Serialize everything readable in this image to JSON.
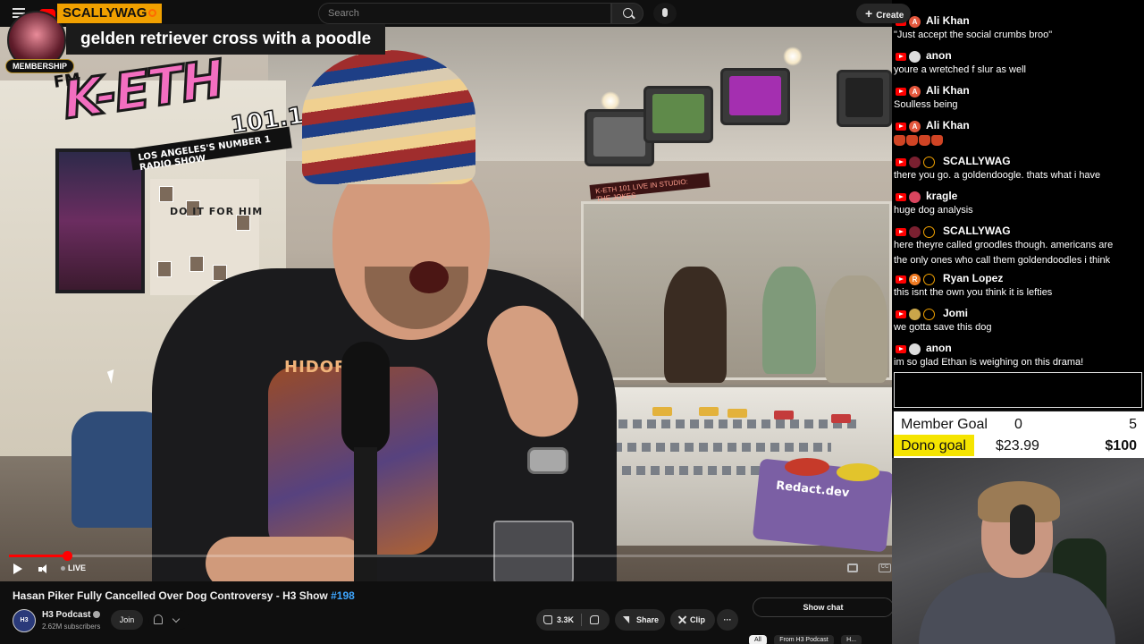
{
  "topbar": {
    "search_placeholder": "Search",
    "create_label": "Create"
  },
  "overlay": {
    "member_badge": "MEMBERSHIP",
    "username": "SCALLYWAG",
    "message": "gelden retriever cross with a poodle"
  },
  "scene": {
    "station_fm": "FM",
    "station_name": "K-ETH",
    "station_freq": "101.1",
    "station_slogan": "LOS ANGELES'S NUMBER 1 RADIO SHOW",
    "board_text": "DO IT FOR HIM",
    "studio_sign": "K-ETH 101 LIVE IN STUDIO: THE JOKES",
    "shirt_text": "HIDORAH",
    "box_label": "Redact.dev"
  },
  "player": {
    "live_label": "LIVE",
    "progress": 0.066
  },
  "video": {
    "title": "Hasan Piker Fully Cancelled Over Dog Controversy - H3 Show ",
    "episode": "#198",
    "channel_name": "H3 Podcast",
    "channel_avatar_text": "H3",
    "subscribers": "2.62M subscribers",
    "join_label": "Join",
    "likes": "3.3K",
    "share_label": "Share",
    "clip_label": "Clip",
    "more_label": "···",
    "show_chat_label": "Show chat",
    "chips": [
      "All",
      "From H3 Podcast",
      "H..."
    ]
  },
  "chat": {
    "messages": [
      {
        "user": "Ali Khan",
        "avatar": "A",
        "avatar_color": "#e4573d",
        "text": "\"Just accept the social crumbs broo\""
      },
      {
        "user": "anon",
        "avatar": "",
        "avatar_color": "#dddddd",
        "text": "youre a wretched f slur as well"
      },
      {
        "user": "Ali Khan",
        "avatar": "A",
        "avatar_color": "#e4573d",
        "text": "Soulless being"
      },
      {
        "user": "Ali Khan",
        "avatar": "A",
        "avatar_color": "#e4573d",
        "text": ""
      },
      {
        "user": "SCALLYWAG",
        "avatar": "",
        "avatar_color": "#7a2030",
        "text": "there you go. a goldendoogle. thats what i have"
      },
      {
        "user": "kragle",
        "avatar": "",
        "avatar_color": "#d9455f",
        "text": "huge dog analysis"
      },
      {
        "user": "SCALLYWAG",
        "avatar": "",
        "avatar_color": "#7a2030",
        "text": "here theyre called groodles though. americans are"
      },
      {
        "user": "Ryan Lopez",
        "avatar": "R",
        "avatar_color": "#f07b22",
        "text": "this isnt the own you think it is lefties"
      },
      {
        "user": "Jomi",
        "avatar": "",
        "avatar_color": "#c9a64a",
        "text": "we gotta save this dog"
      },
      {
        "user": "anon",
        "avatar": "",
        "avatar_color": "#dddddd",
        "text": "im so glad Ethan is weighing on this drama!"
      },
      {
        "user": "SCALLYWAG",
        "avatar": "",
        "avatar_color": "#7a2030",
        "text": "gelden retriever cross with a poodle"
      }
    ],
    "scally_second_line": "the only ones who call them goldendoodles i think",
    "emoji_count": 4
  },
  "goals": {
    "member_label": "Member Goal",
    "member_current": "0",
    "member_target": "5",
    "dono_label": "Dono goal",
    "dono_current": "$23.99",
    "dono_target": "$100",
    "dono_fill_color": "#f5e400"
  },
  "colors": {
    "accent_red": "#ff0000",
    "name_tag_bg": "#f0a000",
    "link_blue": "#3ea6ff"
  }
}
